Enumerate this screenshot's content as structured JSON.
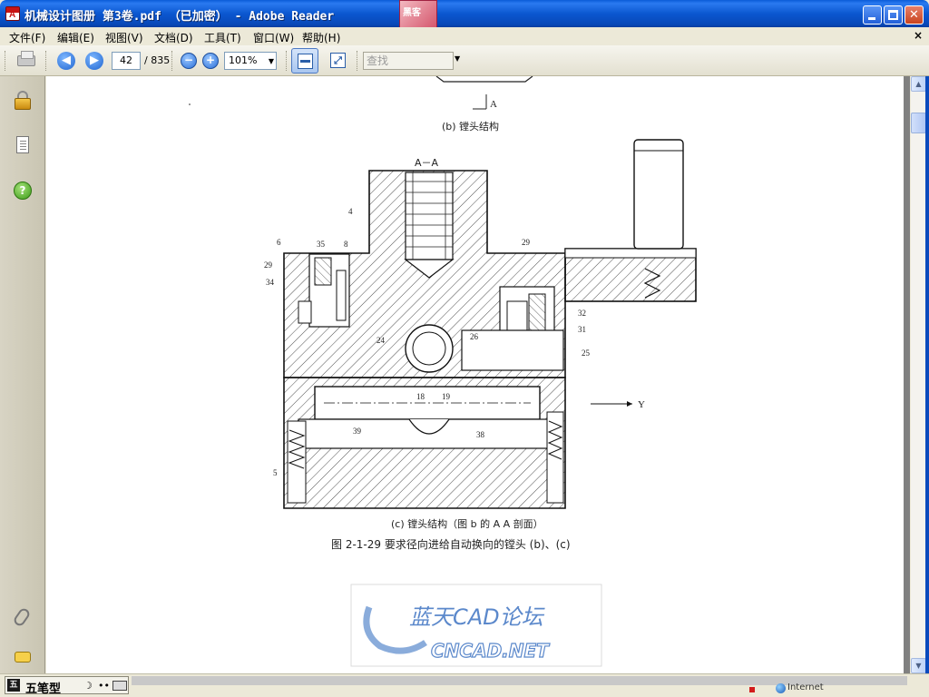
{
  "window": {
    "title": "机械设计图册  第3卷.pdf （已加密） - Adobe Reader",
    "logo_text": "黑客",
    "min_glyph": "_",
    "max_glyph": "□",
    "close_glyph": "✕"
  },
  "menu": {
    "items": [
      {
        "label": "文件(F)"
      },
      {
        "label": "编辑(E)"
      },
      {
        "label": "视图(V)"
      },
      {
        "label": "文档(D)"
      },
      {
        "label": "工具(T)"
      },
      {
        "label": "窗口(W)"
      },
      {
        "label": "帮助(H)"
      }
    ],
    "close_glyph": "×"
  },
  "toolbar": {
    "print_icon": "print-icon",
    "prev_glyph": "◀",
    "next_glyph": "▶",
    "current_page": "42",
    "total_pages": "/ 835",
    "zoom_out_glyph": "−",
    "zoom_in_glyph": "+",
    "zoom_value": "101%",
    "fit_page_glyph": "⤢",
    "search_placeholder": "查找",
    "dropdown_arrow": "▼"
  },
  "navpane": {
    "icons": [
      "lock-icon",
      "pages-icon",
      "help-icon",
      "attachment-icon",
      "comments-icon"
    ],
    "help_glyph": "?"
  },
  "document": {
    "caption_b": "(b) 镗头结构",
    "section_label": "A－A",
    "arrow_a_label": "A",
    "caption_c": "(c) 镗头结构（图 b 的 A A 剖面）",
    "figure_caption": "图 2-1-29  要求径向进给自动换向的镗头 (b)、(c)",
    "arrow_y_label": "Y",
    "callouts": [
      "4",
      "6",
      "35",
      "8",
      "29",
      "34",
      "29",
      "32",
      "31",
      "24",
      "26",
      "25",
      "18",
      "19",
      "39",
      "38",
      "5"
    ],
    "watermark_cn": "蓝天CAD论坛",
    "watermark_en": "CNCAD.NET"
  },
  "scrollbar": {
    "up_glyph": "▲",
    "down_glyph": "▼"
  },
  "status": {
    "ime_logo": "五",
    "ime_text": "五笔型",
    "ime_moon": "☽",
    "ime_dots": "••",
    "zone_text": "Internet"
  }
}
